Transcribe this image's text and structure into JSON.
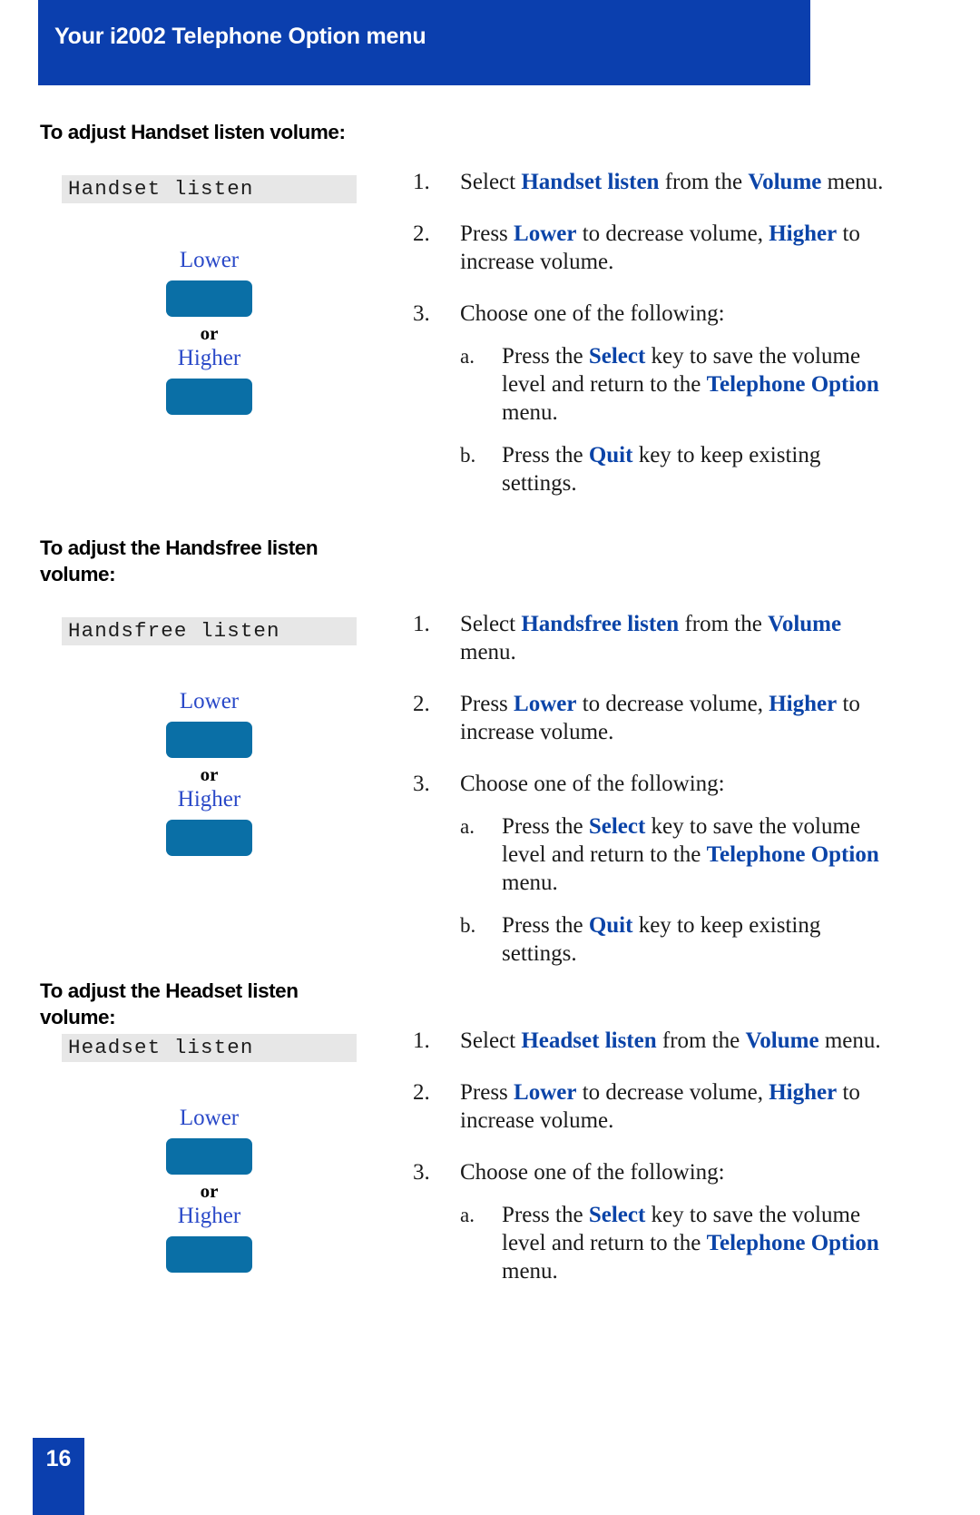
{
  "header": {
    "title": "Your i2002 Telephone Option menu"
  },
  "footer": {
    "page_number": "16"
  },
  "colors": {
    "header_blue": "#0b3fae",
    "keyword_blue": "#0b44a8",
    "key_label_blue": "#2a49c8",
    "key_button_blue": "#0a6fa6",
    "display_gray": "#e7e7e7"
  },
  "sections": [
    {
      "heading": "To adjust Handset listen volume:",
      "display_text": "Handset listen",
      "keys": {
        "lower_label": "Lower",
        "or_label": "or",
        "higher_label": "Higher"
      },
      "steps": [
        {
          "num": "1.",
          "parts": [
            {
              "t": "Select ",
              "kw": false
            },
            {
              "t": "Handset listen",
              "kw": true
            },
            {
              "t": " from the ",
              "kw": false
            },
            {
              "t": "Volume",
              "kw": true
            },
            {
              "t": " menu.",
              "kw": false
            }
          ]
        },
        {
          "num": "2.",
          "parts": [
            {
              "t": "Press ",
              "kw": false
            },
            {
              "t": "Lower",
              "kw": true
            },
            {
              "t": " to decrease volume, ",
              "kw": false
            },
            {
              "t": "Higher",
              "kw": true
            },
            {
              "t": " to increase volume.",
              "kw": false
            }
          ]
        },
        {
          "num": "3.",
          "parts": [
            {
              "t": "Choose one of the following:",
              "kw": false
            }
          ]
        }
      ],
      "substeps": [
        {
          "num": "a.",
          "parts": [
            {
              "t": "Press the ",
              "kw": false
            },
            {
              "t": "Select",
              "kw": true
            },
            {
              "t": " key to save the volume level and return to the ",
              "kw": false
            },
            {
              "t": "Telephone Option",
              "kw": true
            },
            {
              "t": " menu.",
              "kw": false
            }
          ]
        },
        {
          "num": "b.",
          "parts": [
            {
              "t": "Press the ",
              "kw": false
            },
            {
              "t": "Quit",
              "kw": true
            },
            {
              "t": " key to keep existing settings.",
              "kw": false
            }
          ]
        }
      ]
    },
    {
      "heading": "To adjust the Handsfree listen volume:",
      "display_text": "Handsfree listen",
      "keys": {
        "lower_label": "Lower",
        "or_label": "or",
        "higher_label": "Higher"
      },
      "steps": [
        {
          "num": "1.",
          "parts": [
            {
              "t": "Select ",
              "kw": false
            },
            {
              "t": "Handsfree listen",
              "kw": true
            },
            {
              "t": " from the ",
              "kw": false
            },
            {
              "t": "Volume",
              "kw": true
            },
            {
              "t": " menu.",
              "kw": false
            }
          ]
        },
        {
          "num": "2.",
          "parts": [
            {
              "t": "Press ",
              "kw": false
            },
            {
              "t": "Lower",
              "kw": true
            },
            {
              "t": " to decrease volume, ",
              "kw": false
            },
            {
              "t": "Higher",
              "kw": true
            },
            {
              "t": " to increase volume.",
              "kw": false
            }
          ]
        },
        {
          "num": "3.",
          "parts": [
            {
              "t": "Choose one of the following:",
              "kw": false
            }
          ]
        }
      ],
      "substeps": [
        {
          "num": "a.",
          "parts": [
            {
              "t": "Press the ",
              "kw": false
            },
            {
              "t": "Select",
              "kw": true
            },
            {
              "t": " key to save the volume level and return to the ",
              "kw": false
            },
            {
              "t": "Telephone Option",
              "kw": true
            },
            {
              "t": " menu.",
              "kw": false
            }
          ]
        },
        {
          "num": "b.",
          "parts": [
            {
              "t": "Press the ",
              "kw": false
            },
            {
              "t": "Quit",
              "kw": true
            },
            {
              "t": " key to keep existing settings.",
              "kw": false
            }
          ]
        }
      ]
    },
    {
      "heading": "To adjust the Headset listen volume:",
      "display_text": "Headset listen",
      "keys": {
        "lower_label": "Lower",
        "or_label": "or",
        "higher_label": "Higher"
      },
      "steps": [
        {
          "num": "1.",
          "parts": [
            {
              "t": "Select ",
              "kw": false
            },
            {
              "t": "Headset listen",
              "kw": true
            },
            {
              "t": " from the ",
              "kw": false
            },
            {
              "t": "Volume",
              "kw": true
            },
            {
              "t": " menu.",
              "kw": false
            }
          ]
        },
        {
          "num": "2.",
          "parts": [
            {
              "t": "Press ",
              "kw": false
            },
            {
              "t": "Lower",
              "kw": true
            },
            {
              "t": " to decrease volume, ",
              "kw": false
            },
            {
              "t": "Higher",
              "kw": true
            },
            {
              "t": " to increase volume.",
              "kw": false
            }
          ]
        },
        {
          "num": "3.",
          "parts": [
            {
              "t": "Choose one of the following:",
              "kw": false
            }
          ]
        }
      ],
      "substeps": [
        {
          "num": "a.",
          "parts": [
            {
              "t": "Press the ",
              "kw": false
            },
            {
              "t": "Select",
              "kw": true
            },
            {
              "t": " key to save the volume level and return to the ",
              "kw": false
            },
            {
              "t": "Telephone Option",
              "kw": true
            },
            {
              "t": " menu.",
              "kw": false
            }
          ]
        }
      ]
    }
  ],
  "layout": {
    "section_tops": [
      118,
      575,
      1062
    ],
    "heading_tops": [
      131,
      589,
      1077
    ],
    "display_tops": [
      193,
      680,
      1139
    ],
    "key_stack_tops": [
      272,
      758,
      1217
    ],
    "right_col_tops": [
      185,
      672,
      1131
    ],
    "right_col_lefts": [
      455,
      455,
      455
    ],
    "right_col_widths": [
      470,
      470,
      500
    ]
  }
}
